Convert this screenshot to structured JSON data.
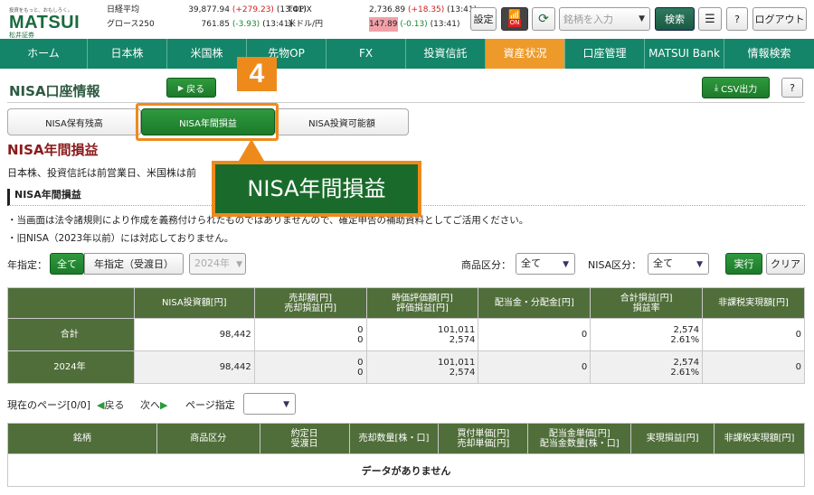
{
  "logo": {
    "tagline": "投資をもっと、おもしろく。",
    "brand": "MATSUI",
    "sub": "松井証券"
  },
  "market": {
    "nikkei": {
      "label": "日経平均",
      "value": "39,877.94",
      "change": "(+279.23)",
      "time": "(13:41)"
    },
    "growth": {
      "label": "グロース250",
      "value": "761.85",
      "change": "(-3.93)",
      "time": "(13:41)"
    },
    "topix": {
      "label": "TOPIX",
      "value": "2,736.89",
      "change": "(+18.35)",
      "time": "(13:41)"
    },
    "usdjpy": {
      "label": "米ドル/円",
      "value": "147.89",
      "change": "(-0.13)",
      "time": "(13:41)"
    }
  },
  "toolbar": {
    "settings": "設定",
    "on_badge": "ON",
    "search_placeholder": "銘柄を入力",
    "search_btn": "検索",
    "help": "?",
    "logout": "ログアウト"
  },
  "nav": [
    "ホーム",
    "日本株",
    "米国株",
    "先物OP",
    "FX",
    "投資信託",
    "資産状況",
    "口座管理",
    "MATSUI Bank",
    "情報検索"
  ],
  "page": {
    "title": "NISA口座情報",
    "back": "戻る",
    "csv": "CSV出力",
    "help": "?"
  },
  "tabs": [
    "NISA保有残高",
    "NISA年間損益",
    "NISA投資可能額"
  ],
  "section": {
    "title": "NISA年間損益",
    "desc": "日本株、投資信託は前営業日、米国株は前",
    "sub": "NISA年間損益"
  },
  "notes": [
    "・当画面は法令諸規則により作成を義務付けられたものではありませんので、確定申告の補助資料としてご活用ください。",
    "・旧NISA（2023年以前）には対応しておりません。"
  ],
  "filters": {
    "year_label": "年指定：",
    "all": "全て",
    "by_year": "年指定（受渡日）",
    "year_value": "2024年",
    "product_label": "商品区分：",
    "product_value": "全て",
    "nisa_label": "NISA区分：",
    "nisa_value": "全て",
    "run": "実行",
    "clear": "クリア"
  },
  "summary": {
    "headers": [
      "",
      "NISA投資額[円]",
      "売却額[円]\n売却損益[円]",
      "時価評価額[円]\n評価損益[円]",
      "配当金・分配金[円]",
      "合計損益[円]\n損益率",
      "非課税実現額[円]"
    ],
    "rows": [
      {
        "label": "合計",
        "invest": "98,442",
        "sell": "0",
        "sell_pl": "0",
        "mv": "101,011",
        "mv_pl": "2,574",
        "div": "0",
        "total": "2,574",
        "rate": "2.61%",
        "taxfree": "0"
      },
      {
        "label": "2024年",
        "invest": "98,442",
        "sell": "0",
        "sell_pl": "0",
        "mv": "101,011",
        "mv_pl": "2,574",
        "div": "0",
        "total": "2,574",
        "rate": "2.61%",
        "taxfree": "0"
      }
    ]
  },
  "pager": {
    "current": "現在のページ[0/0]",
    "prev": "戻る",
    "next": "次へ",
    "jump": "ページ指定"
  },
  "detail": {
    "headers": [
      "銘柄",
      "商品区分",
      "約定日\n受渡日",
      "売却数量[株・口]",
      "買付単価[円]\n売却単価[円]",
      "配当金単価[円]\n配当金数量[株・口]",
      "実現損益[円]",
      "非課税実現額[円]"
    ],
    "empty": "データがありません"
  },
  "callout": {
    "number": "4",
    "label": "NISA年間損益"
  }
}
